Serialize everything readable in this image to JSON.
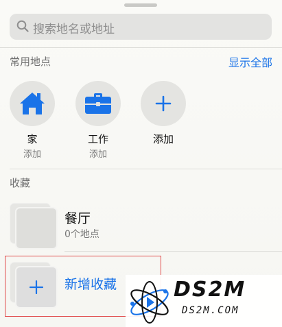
{
  "search": {
    "placeholder": "搜索地名或地址"
  },
  "favorites": {
    "title": "常用地点",
    "show_all": "显示全部",
    "items": [
      {
        "name": "家",
        "sub": "添加",
        "icon": "home-icon"
      },
      {
        "name": "工作",
        "sub": "添加",
        "icon": "briefcase-icon"
      },
      {
        "name": "添加",
        "sub": "",
        "icon": "plus-icon"
      }
    ]
  },
  "collections": {
    "title": "收藏",
    "items": [
      {
        "name": "餐厅",
        "count": "0个地点"
      }
    ],
    "new_label": "新增收藏"
  },
  "watermark": {
    "big": "DS2M",
    "small": "DS2M.COM"
  },
  "colors": {
    "accent": "#1a73e8",
    "highlight_border": "#e04a4a"
  }
}
